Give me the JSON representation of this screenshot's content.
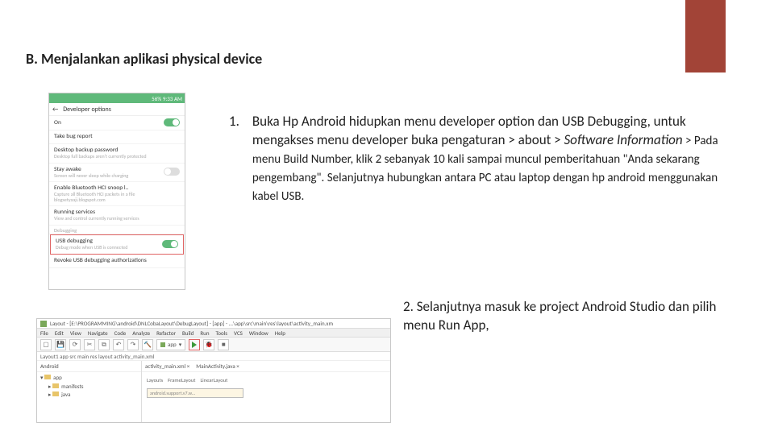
{
  "heading": "B. Menjalankan aplikasi physical device",
  "step1": {
    "num": "1.",
    "line1a": "Buka Hp Android hidupkan menu developer option dan USB Debugging, untuk mengakses menu developer buka pengaturan > about > ",
    "line1b_italic": "Software Information",
    "line2": " > Pada menu Build Number, klik 2 sebanyak 10 kali sampai muncul pemberitahuan \"Anda sekarang pengembang\". Selanjutnya hubungkan antara PC atau laptop dengan hp android menggunakan kabel USB."
  },
  "step2": "2. Selanjutnya masuk ke project Android Studio dan pilih menu Run App,",
  "phone": {
    "status_right": "56%  9:33 AM",
    "title": "Developer options",
    "on": "On",
    "take_bug": "Take bug report",
    "backup_t": "Desktop backup password",
    "backup_s": "Desktop full backups aren't currently protected",
    "stay_t": "Stay awake",
    "stay_s": "Screen will never sleep while charging",
    "hdcp_t": "Enable Bluetooth HCI snoop l..",
    "hdcp_s": "Capture all Bluetooth HCI packets in a file",
    "blog": "blogsetyaaji.blogspot.com",
    "run_t": "Running services",
    "run_s": "View and control currently running services",
    "debug_section": "Debugging",
    "usb_t": "USB debugging",
    "usb_s": "Debug mode when USB is connected",
    "revoke": "Revoke USB debugging authorizations"
  },
  "ide": {
    "title": "Layout - [E:\\PROGRAMMING\\android\\DNLCobaLayout\\DebugLayout] - [app] - ...\\app\\src\\main\\res\\layout\\activity_main.xm",
    "menu": [
      "File",
      "Edit",
      "View",
      "Navigate",
      "Code",
      "Analyze",
      "Refactor",
      "Build",
      "Run",
      "Tools",
      "VCS",
      "Window",
      "Help"
    ],
    "crumbs": "Layout1   app   src   main   res   layout   activity_main.xml",
    "app_drop": "app",
    "left_hdr": "Android",
    "tree": {
      "root": "app",
      "child1": "manifests",
      "child2": "java"
    },
    "tabs": {
      "a": "activity_main.xml ×",
      "b": "MainActivity.java ×"
    },
    "palette": [
      "Layouts",
      "FrameLayout",
      "LinearLayout"
    ],
    "field": "android.support.v7.w..."
  }
}
